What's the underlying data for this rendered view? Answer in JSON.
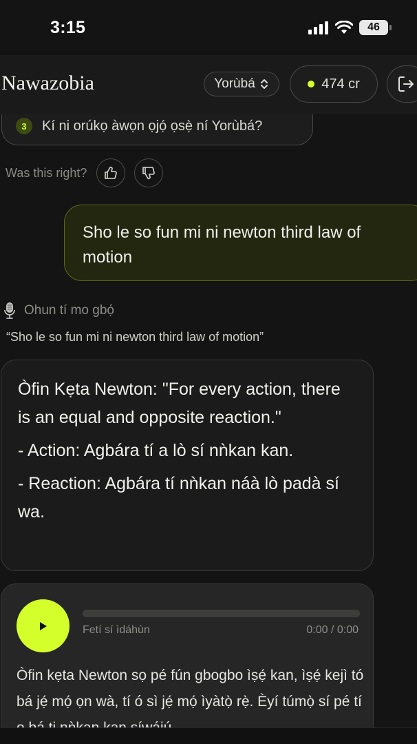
{
  "status_bar": {
    "time": "3:15",
    "battery": "46"
  },
  "header": {
    "brand": "Nawazobia",
    "language": "Yorùbá",
    "credits": "474 cr",
    "accent": "#d4ff2a"
  },
  "suggestion": {
    "number": "3",
    "text": "Kí ni orúkọ àwọn ọjọ́ ọsẹ̀ ní Yorùbá?"
  },
  "feedback": {
    "label": "Was this right?"
  },
  "user_message": {
    "text": "Sho le so fun mi ni newton third law of motion"
  },
  "voice": {
    "label": "Ohun tí mo gbọ́",
    "transcript": "“Sho le so fun mi ni newton third law of motion”"
  },
  "answer": {
    "line1": "Òfin Kẹta Newton: \"For every action, there is an equal and opposite reaction.\"",
    "line2": "- Action: Agbára tí a lò sí nǹkan kan.",
    "line3": "- Reaction: Agbára tí nǹkan náà lò padà sí wa."
  },
  "audio": {
    "label": "Fetí sí ìdáhùn",
    "time": "0:00 / 0:00",
    "progress": 0,
    "text": "Òfin kẹta Newton sọ pé fún gbogbo ìṣẹ́ kan, ìṣẹ́ kejì tó bá jẹ́ mọ́ ọn wà, tí ó sì jẹ́ mọ́ ìyàtọ̀ rẹ̀. Èyí túmọ̀ sí pé tí o bá ti nǹkan kan síwájú"
  }
}
